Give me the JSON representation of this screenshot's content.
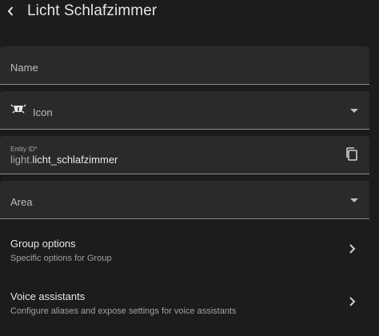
{
  "header": {
    "back_icon": "chevron-left-icon",
    "title": "Licht Schlafzimmer"
  },
  "form": {
    "name_label": "Name",
    "icon_label": "Icon",
    "icon_icon": "ceiling-light-icon",
    "entity_id_label": "Entity ID*",
    "entity_id_prefix": "light.",
    "entity_id_suffix": "licht_schlafzimmer",
    "copy_icon": "content-copy-icon",
    "area_label": "Area"
  },
  "options": [
    {
      "title": "Group options",
      "subtitle": "Specific options for Group",
      "icon": "chevron-right-icon"
    },
    {
      "title": "Voice assistants",
      "subtitle": "Configure aliases and expose settings for voice assistants",
      "icon": "chevron-right-icon"
    }
  ],
  "colors": {
    "background": "#1c1c1c",
    "field_background": "#2a2a2a",
    "text_primary": "#e1e1e1",
    "text_secondary": "#a0a0a0"
  }
}
